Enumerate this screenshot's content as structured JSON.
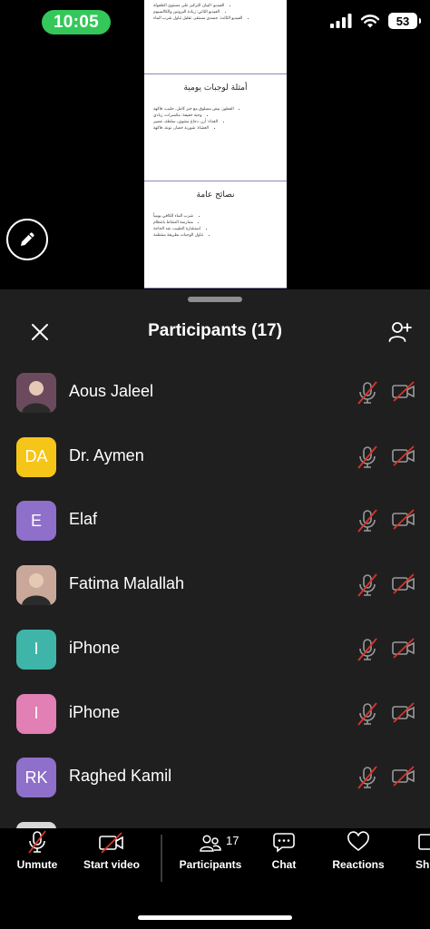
{
  "status_bar": {
    "time": "10:05",
    "battery": "53"
  },
  "shared_doc": {
    "slides": [
      {
        "title": "",
        "bullets": [
          "الفيديو: البيان التركيز على مستوى الطفولة",
          "الفيديو الثاني: زيادة البروتين والكالسيوم",
          "الفيديو الثالث: جسدي مستقر، تقليل تناول شرب الماء"
        ]
      },
      {
        "title": "أمثلة لوجبات يومية",
        "bullets": [
          "الفطور: بيض مسلوق مع خبز كامل، حليب، فاكهة",
          "وجبة خفيفة: مكسرات، زبادي",
          "الغداء: أرز، دجاج مشوي، سلطة، عصير",
          "العشاء: شوربة خضار، تونة، فاكهة"
        ]
      },
      {
        "title": "نصائح عامة",
        "bullets": [
          "شرب الماء الكافي يومياً",
          "ممارسة النشاط بانتظام",
          "استشارة الطبيب عند الحاجة",
          "تناول الوجبات بطريقة منتظمة"
        ]
      }
    ]
  },
  "panel": {
    "title": "Participants (17)"
  },
  "participants": [
    {
      "name": "Aous Jaleel",
      "initials": "",
      "color": "#6b4a5e",
      "photo": true
    },
    {
      "name": "Dr. Aymen",
      "initials": "DA",
      "color": "#f5c518",
      "photo": false
    },
    {
      "name": "Elaf",
      "initials": "E",
      "color": "#8e6fc9",
      "photo": false
    },
    {
      "name": "Fatima Malallah",
      "initials": "",
      "color": "#c9a89a",
      "photo": true
    },
    {
      "name": "iPhone",
      "initials": "I",
      "color": "#3eb5a8",
      "photo": false
    },
    {
      "name": "iPhone",
      "initials": "I",
      "color": "#e27fb4",
      "photo": false
    },
    {
      "name": "Raghed Kamil",
      "initials": "RK",
      "color": "#8e6fc9",
      "photo": false
    }
  ],
  "toolbar": {
    "unmute": "Unmute",
    "start_video": "Start video",
    "participants": "Participants",
    "participants_count": "17",
    "chat": "Chat",
    "reactions": "Reactions",
    "share": "Sh"
  },
  "colors": {
    "muted_red": "#d9342b",
    "sheet_bg": "#1f1f1f"
  }
}
